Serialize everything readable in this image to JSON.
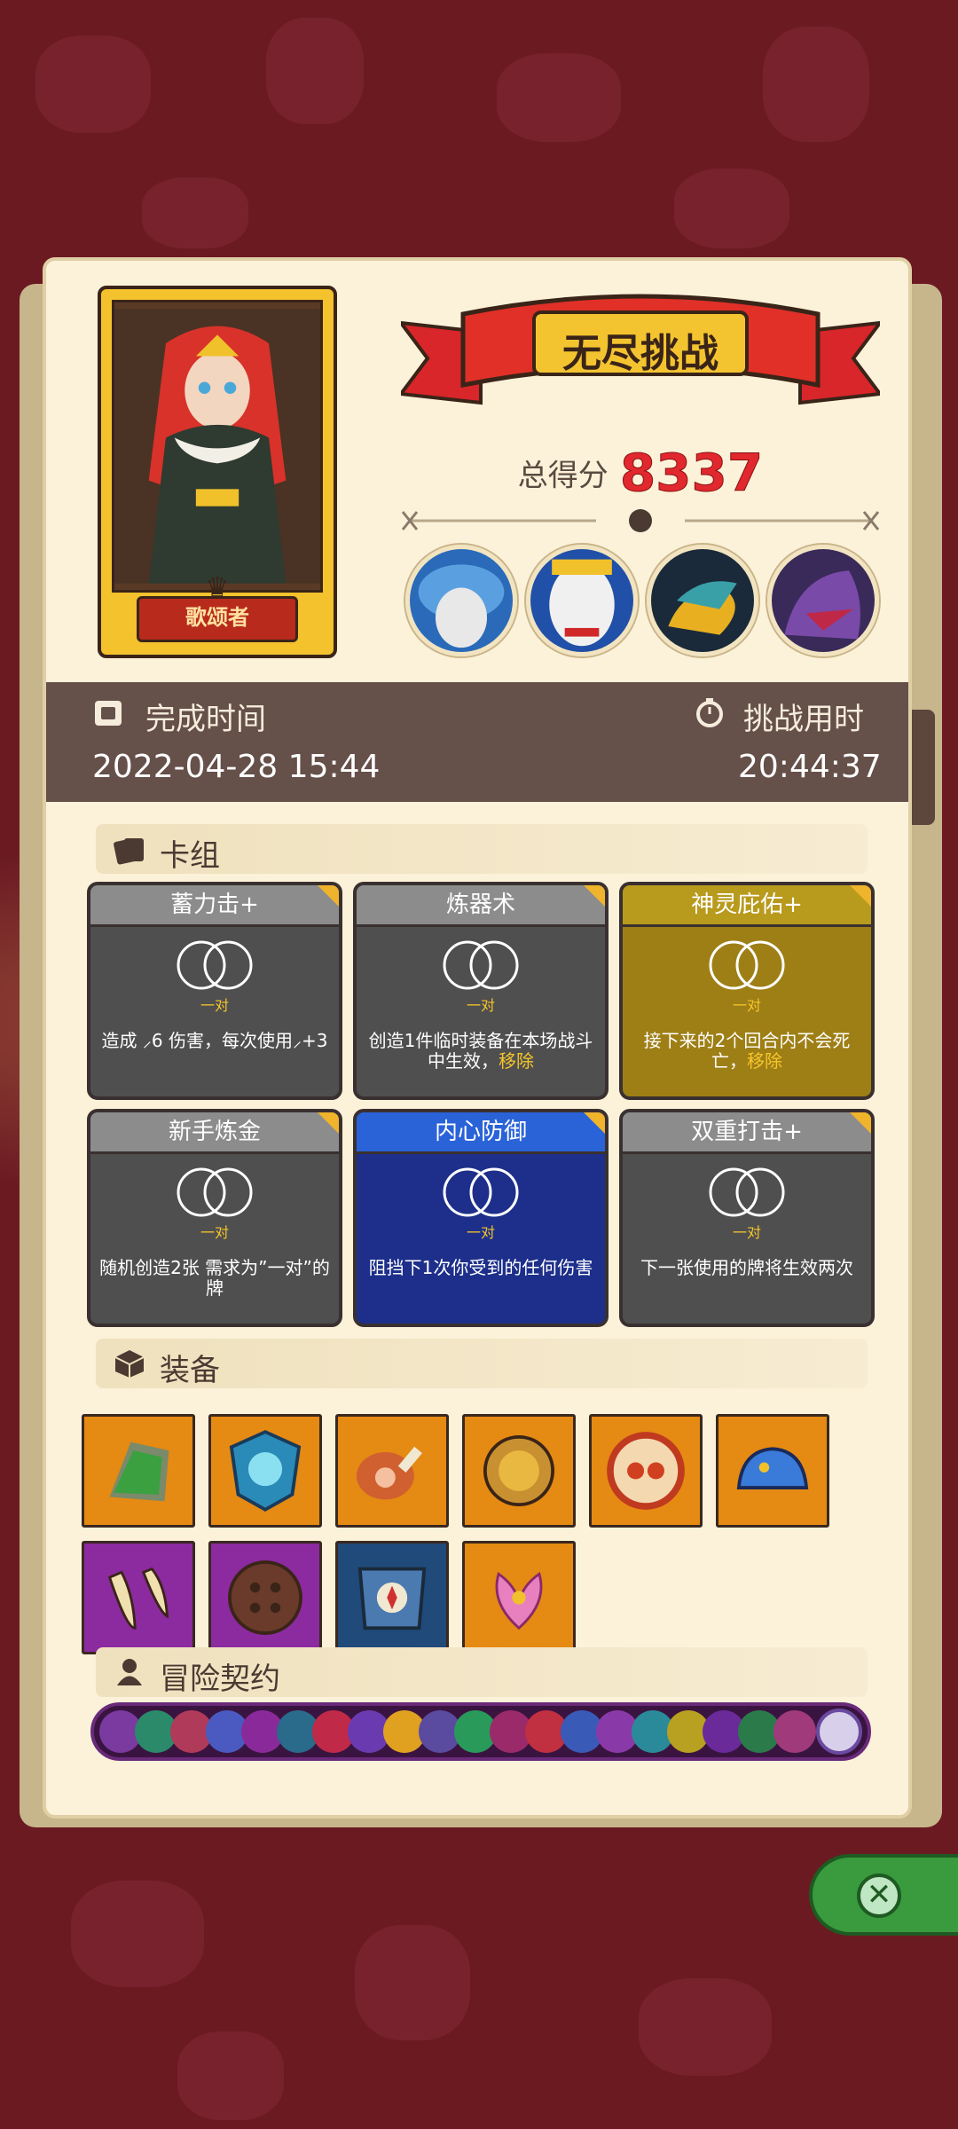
{
  "hero": {
    "name": "歌颂者"
  },
  "challenge": {
    "title": "无尽挑战",
    "score_label": "总得分",
    "score": "8337"
  },
  "time_info": {
    "finish_label": "完成时间",
    "finish_value": "2022-04-28 15:44",
    "duration_label": "挑战用时",
    "duration_value": "20:44:37"
  },
  "deck": {
    "title": "卡组",
    "cards": [
      {
        "name": "蓄力击+",
        "pair": "一对",
        "desc": "造成 ⸝6 伤害，每次使用⸝+3",
        "highlight": "",
        "style": "grey"
      },
      {
        "name": "炼器术",
        "pair": "一对",
        "desc": "创造1件临时装备在本场战斗中生效，",
        "highlight": "移除",
        "style": "grey"
      },
      {
        "name": "神灵庇佑+",
        "pair": "一对",
        "desc": "接下来的2个回合内不会死亡，",
        "highlight": "移除",
        "style": "gold"
      },
      {
        "name": "新手炼金",
        "pair": "一对",
        "desc": "随机创造2张 需求为”一对”的牌",
        "highlight": "",
        "style": "grey"
      },
      {
        "name": "内心防御",
        "pair": "一对",
        "desc": "阻挡下1次你受到的任何伤害",
        "highlight": "",
        "style": "blue"
      },
      {
        "name": "双重打击+",
        "pair": "一对",
        "desc": "下一张使用的牌将生效两次",
        "highlight": "",
        "style": "grey"
      }
    ]
  },
  "equipment": {
    "title": "装备",
    "items": [
      {
        "icon": "moss-stone-icon",
        "color": "orange"
      },
      {
        "icon": "crystal-shield-icon",
        "color": "orange"
      },
      {
        "icon": "ham-icon",
        "color": "orange"
      },
      {
        "icon": "lion-ring-icon",
        "color": "orange"
      },
      {
        "icon": "eye-amulet-icon",
        "color": "orange"
      },
      {
        "icon": "blue-slime-icon",
        "color": "orange"
      },
      {
        "icon": "fang-icon",
        "color": "purple"
      },
      {
        "icon": "button-icon",
        "color": "purple"
      },
      {
        "icon": "compass-armor-icon",
        "color": "navy"
      },
      {
        "icon": "lotus-icon",
        "color": "orange"
      }
    ]
  },
  "contract": {
    "title": "冒险契约"
  },
  "colors": {
    "accent": "#e0282e",
    "panel": "#fbf2d9",
    "timebar": "#66504a"
  }
}
